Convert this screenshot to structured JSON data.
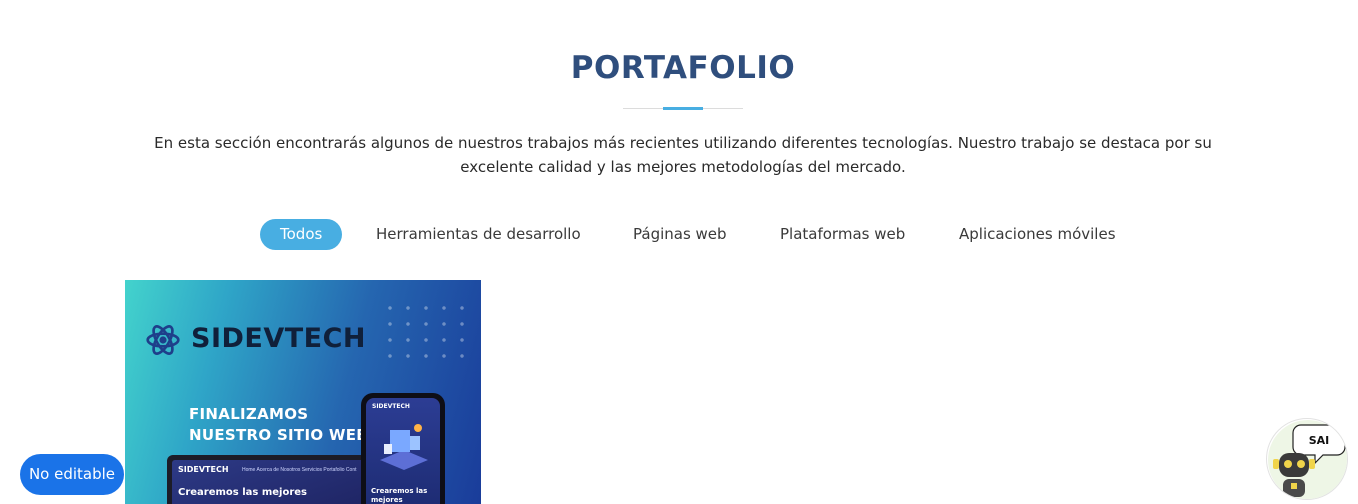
{
  "section": {
    "title": "PORTAFOLIO",
    "description": "En esta sección encontrarás algunos de nuestros trabajos más recientes utilizando diferentes tecnologías. Nuestro trabajo se destaca por su excelente calidad y las mejores metodologías del mercado."
  },
  "filters": [
    {
      "label": "Todos",
      "active": true
    },
    {
      "label": "Herramientas de desarrollo",
      "active": false
    },
    {
      "label": "Páginas web",
      "active": false
    },
    {
      "label": "Plataformas web",
      "active": false
    },
    {
      "label": "Aplicaciones móviles",
      "active": false
    }
  ],
  "portfolio_card": {
    "brand": "SIDEVTECH",
    "headline_line1": "FINALIZAMOS",
    "headline_line2": "NUESTRO SITIO WEB",
    "laptop_brand": "SIDEVTECH",
    "laptop_menu": "Home    Acerca de Nosotros    Servicios    Portafolio    Cont",
    "laptop_headline": "Crearemos las mejores",
    "phone_brand": "SIDEVTECH",
    "phone_headline": "Crearemos las mejores soluciones para tu nego"
  },
  "badge": {
    "label": "No editable"
  },
  "assistant": {
    "label": "SAI"
  },
  "colors": {
    "title": "#2f4e7d",
    "accent": "#48aee2",
    "badge": "#1a73e8"
  }
}
